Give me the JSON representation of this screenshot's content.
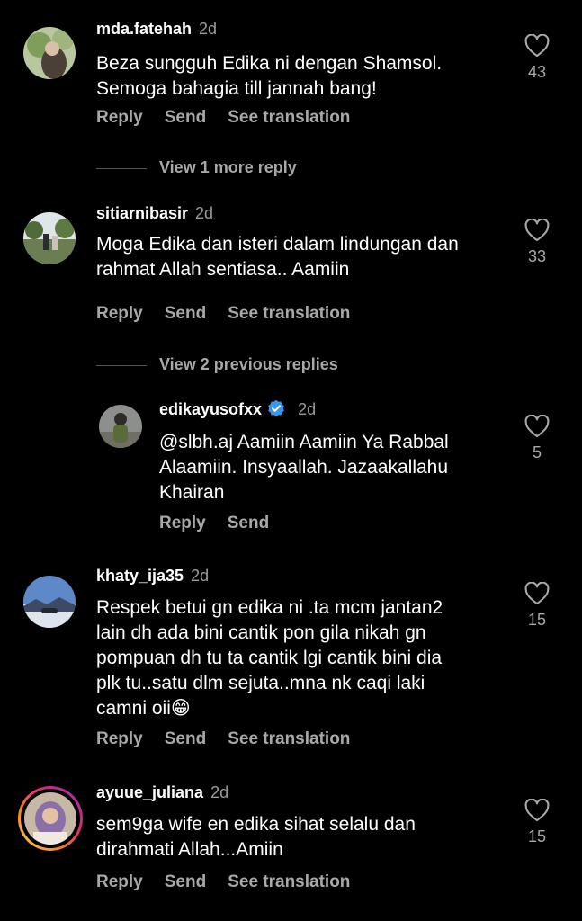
{
  "comments": [
    {
      "username": "mda.fatehah",
      "time": "2d",
      "text_lines": [
        "Beza sungguh Edika ni dengan Shamsol.",
        "Semoga bahagia till jannah bang!"
      ],
      "likes": "43",
      "actions": [
        "Reply",
        "Send",
        "See translation"
      ],
      "view_more": "View 1 more reply"
    },
    {
      "username": "sitiarnibasir",
      "time": "2d",
      "text_lines": [
        "Moga Edika dan isteri dalam lindungan dan",
        "rahmat Allah sentiasa.. Aamiin"
      ],
      "likes": "33",
      "actions": [
        "Reply",
        "Send",
        "See translation"
      ],
      "view_more": "View 2 previous replies"
    },
    {
      "username": "edikayusofxx",
      "time": "2d",
      "text_lines": [
        "@slbh.aj Aamiin Aamiin Ya Rabbal",
        "Alaamiin. Insyaallah. Jazaakallahu",
        "Khairan"
      ],
      "likes": "5",
      "actions": [
        "Reply",
        "Send"
      ]
    },
    {
      "username": "khaty_ija35",
      "time": "2d",
      "text_lines": [
        "Respek betui gn edika ni .ta mcm jantan2",
        "lain dh ada bini cantik pon gila nikah gn",
        "pompuan dh tu ta cantik lgi cantik bini dia",
        "plk tu..satu dlm sejuta..mna nk caqi laki",
        "camni oii😁"
      ],
      "likes": "15",
      "actions": [
        "Reply",
        "Send",
        "See translation"
      ]
    },
    {
      "username": "ayuue_juliana",
      "time": "2d",
      "text_lines": [
        "sem9ga wife en edika sihat selalu dan",
        "dirahmati Allah...Amiin"
      ],
      "likes": "15",
      "actions": [
        "Reply",
        "Send",
        "See translation"
      ]
    }
  ],
  "colors": {
    "background": "#000000",
    "muted": "#a8a8a8",
    "verified": "#3797f0",
    "story_ring": "#d6249f"
  },
  "icons": {
    "like": "heart-outline-icon",
    "verified": "verified-badge-icon"
  }
}
